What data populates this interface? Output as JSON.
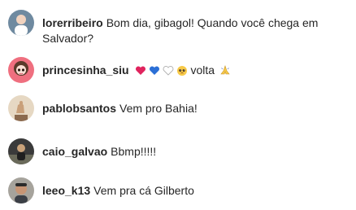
{
  "comments": [
    {
      "username": "lorerribeiro",
      "text": "Bom dia, gibagol! Quando você chega em Salvador?"
    },
    {
      "username": "princesinha_siu",
      "emojis": [
        "red-heart-icon",
        "blue-heart-icon",
        "white-heart-icon",
        "pleading-face-icon"
      ],
      "text": "volta",
      "trailing_emoji": "folded-hands-icon"
    },
    {
      "username": "pablobsantos",
      "text": "Vem pro Bahia!"
    },
    {
      "username": "caio_galvao",
      "text": "Bbmp!!!!!"
    },
    {
      "username": "leeo_k13",
      "text": "Vem pra cá Gilberto"
    }
  ],
  "colors": {
    "text": "#262626",
    "background": "#ffffff",
    "red_heart": "#e0245e",
    "blue_heart": "#2b6fd6",
    "emoji_yellow": "#f7c948"
  }
}
